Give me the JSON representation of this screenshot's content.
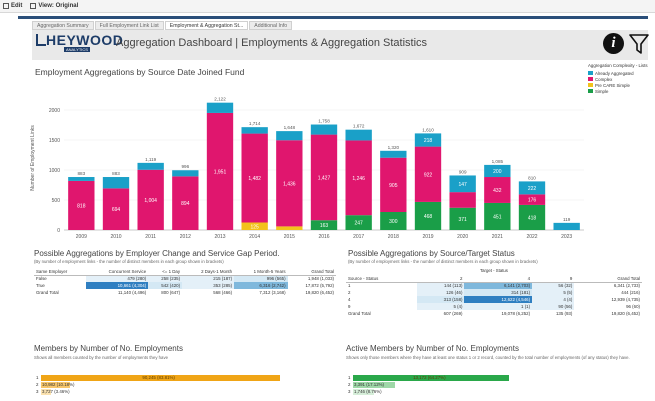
{
  "toolbar": {
    "edit_label": "Edit",
    "view_label": "View: Original"
  },
  "tabs": [
    {
      "label": "Aggregation Summary"
    },
    {
      "label": "Full Employment Link List"
    },
    {
      "label": "Employment & Aggregation St..."
    },
    {
      "label": "Additional Info"
    }
  ],
  "header": {
    "logo_text": "HEYWOOD",
    "logo_sub": "ANALYTICS",
    "title": "Aggregation Dashboard | Employments & Aggregation Statistics",
    "info_icon": "info-icon",
    "filter_icon": "filter-icon"
  },
  "colors": {
    "already": "#1aa0c8",
    "complex": "#e0166e",
    "precare": "#f2c21b",
    "simple": "#1a9e48",
    "highlight_dark": "#2f7fc1",
    "highlight_light": "#9ecae1",
    "highlight_pale": "#d4e8f4",
    "orange": "#f0a516",
    "green": "#2aa84a",
    "green_light": "#9fd8a8"
  },
  "main_chart": {
    "title": "Employment Aggregations by Source Date Joined Fund",
    "legend_title": "Aggregation Complexity - Lists",
    "legend": [
      "Already Aggregated",
      "Complex",
      "Pre CARE Simple",
      "Simple"
    ],
    "chart_data": {
      "type": "bar",
      "stacked": true,
      "ylabel": "Number of Employment Links",
      "ylim": [
        0,
        2400
      ],
      "yticks": [
        "0",
        "500",
        "1000",
        "1500",
        "2000"
      ],
      "categories": [
        "2009",
        "2010",
        "2011",
        "2012",
        "2013",
        "2014",
        "2015",
        "2016",
        "2017",
        "2018",
        "2019",
        "2020",
        "2021",
        "2022",
        "2023"
      ],
      "totals": [
        "883",
        "883",
        "1,119",
        "996",
        "2,122",
        "1,714",
        "1,648",
        "1,758",
        "1,672",
        "1,320",
        "1,610",
        "909",
        "1,085",
        "810",
        "119"
      ],
      "series": [
        {
          "name": "Simple",
          "values": [
            0,
            0,
            0,
            0,
            0,
            0,
            0,
            163,
            247,
            300,
            468,
            371,
            451,
            418,
            0
          ],
          "labels": [
            "",
            "",
            "",
            "",
            "",
            "",
            "",
            "163",
            "247",
            "300",
            "468",
            "371",
            "451",
            "418",
            ""
          ]
        },
        {
          "name": "Pre CARE Simple",
          "values": [
            0,
            0,
            0,
            0,
            0,
            125,
            60,
            0,
            0,
            0,
            0,
            0,
            0,
            0,
            0
          ],
          "labels": [
            "",
            "",
            "",
            "",
            "",
            "125",
            "",
            "",
            "",
            "",
            "",
            "",
            "",
            "",
            ""
          ]
        },
        {
          "name": "Complex",
          "values": [
            818,
            694,
            1004,
            894,
            1951,
            1482,
            1436,
            1427,
            1246,
            905,
            922,
            260,
            432,
            176,
            0
          ],
          "labels": [
            "818",
            "694",
            "1,004",
            "894",
            "1,951",
            "1,482",
            "1,436",
            "1,427",
            "1,246",
            "905",
            "922",
            "",
            "432",
            "176",
            ""
          ]
        },
        {
          "name": "Already Aggregated",
          "values": [
            65,
            189,
            115,
            102,
            171,
            107,
            152,
            168,
            179,
            115,
            220,
            278,
            202,
            216,
            119
          ],
          "labels": [
            "",
            "",
            "",
            "",
            "",
            "",
            "",
            "",
            "",
            "",
            "218",
            "147",
            "200",
            "222",
            ""
          ]
        }
      ]
    }
  },
  "table1": {
    "title": "Possible Aggregations by Employer Change and Service Gap Period.",
    "subtitle": "(By number of employment links - the number of distinct members in each group shown in brackets)",
    "headers": [
      "Same Employer",
      "Concurrent Service",
      "<= 1 Day",
      "2 Days-1 Month",
      "1 Month-5 Years",
      "Grand Total"
    ],
    "rows": [
      [
        "False",
        "479 (280)",
        "258 (235)",
        "215 (187)",
        "996 (565)",
        "1,948 (1,033)"
      ],
      [
        "True",
        "10,661 (4,304)",
        "542 (420)",
        "353 (285)",
        "6,316 (2,742)",
        "17,872 (5,792)"
      ],
      [
        "Grand Total",
        "11,140 (4,496)",
        "800 (647)",
        "568 (466)",
        "7,312 (3,168)",
        "19,820 (6,452)"
      ]
    ]
  },
  "table2": {
    "title": "Possible Aggregations by Source/Target Status",
    "subtitle": "(By number of employment links - the number of distinct members in each group shown in brackets)",
    "target_header": "Target - Status",
    "headers": [
      "Source - Status",
      "2",
      "4",
      "9",
      "Grand Total"
    ],
    "rows": [
      [
        "1",
        "144 (113)",
        "6,141 (2,703)",
        "56 (32)",
        "6,341 (2,733)"
      ],
      [
        "2",
        "126 (46)",
        "314 (181)",
        "5 (5)",
        "444 (216)"
      ],
      [
        "4",
        "313 (158)",
        "12,622 (4,546)",
        "4 (4)",
        "12,939 (4,735)"
      ],
      [
        "9",
        "5 (4)",
        "1 (1)",
        "90 (56)",
        "96 (60)"
      ],
      [
        "Grand Total",
        "607 (269)",
        "19,078 (6,252)",
        "135 (93)",
        "19,820 (6,452)"
      ]
    ]
  },
  "members1": {
    "title": "Members by Number of No. Employments",
    "subtitle": "Shows all members counted by the number of employments they have",
    "rows": [
      {
        "label": "1",
        "value": "90,245 (83.81%)"
      },
      {
        "label": "2",
        "value": "10,982 (10.18%)"
      },
      {
        "label": "3",
        "value": "3,727 (3.46%)"
      }
    ],
    "fractions": [
      0.8381,
      0.1018,
      0.0346
    ]
  },
  "members2": {
    "title": "Active Members by Number of No. Employments",
    "subtitle": "Shows only those members where they have at least one status 1 or 2 record, counted by the total number of employments (of any status) they have.",
    "rows": [
      {
        "label": "1",
        "value": "13,172 (64.27%)"
      },
      {
        "label": "2",
        "value": "3,391 (17.12%)"
      },
      {
        "label": "3",
        "value": "1,746 (8.76%)"
      }
    ],
    "fractions": [
      0.6427,
      0.1712,
      0.0876
    ]
  }
}
